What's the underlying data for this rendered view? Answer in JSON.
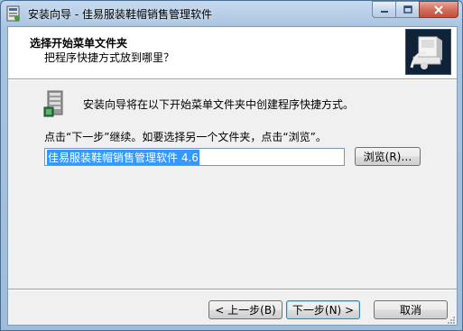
{
  "window": {
    "title": "安装向导 - 佳易服装鞋帽销售管理软件",
    "icon": "installer-app-icon",
    "controls": {
      "minimize": "minimize-icon",
      "maximize": "maximize-icon",
      "close": "close-icon"
    }
  },
  "header": {
    "title": "选择开始菜单文件夹",
    "subtitle": "把程序快捷方式放到哪里？",
    "image": "computer-install-icon"
  },
  "body": {
    "intro": "安装向导将在以下开始菜单文件夹中创建程序快捷方式。",
    "instruction": "点击“下一步”继续。如要选择另一个文件夹，点击“浏览”。",
    "folder_value": "佳易服装鞋帽销售管理软件 4.6",
    "browse_label": "浏览(R)…",
    "folder_icon": "start-menu-folder-icon"
  },
  "footer": {
    "back_label": "< 上一步(B)",
    "next_label": "下一步(N) >",
    "cancel_label": "取消"
  },
  "colors": {
    "titlebar": "#a9c4e0",
    "client_bg": "#f0f0f0",
    "selection": "#3399ff",
    "header_bg": "#ffffff"
  }
}
